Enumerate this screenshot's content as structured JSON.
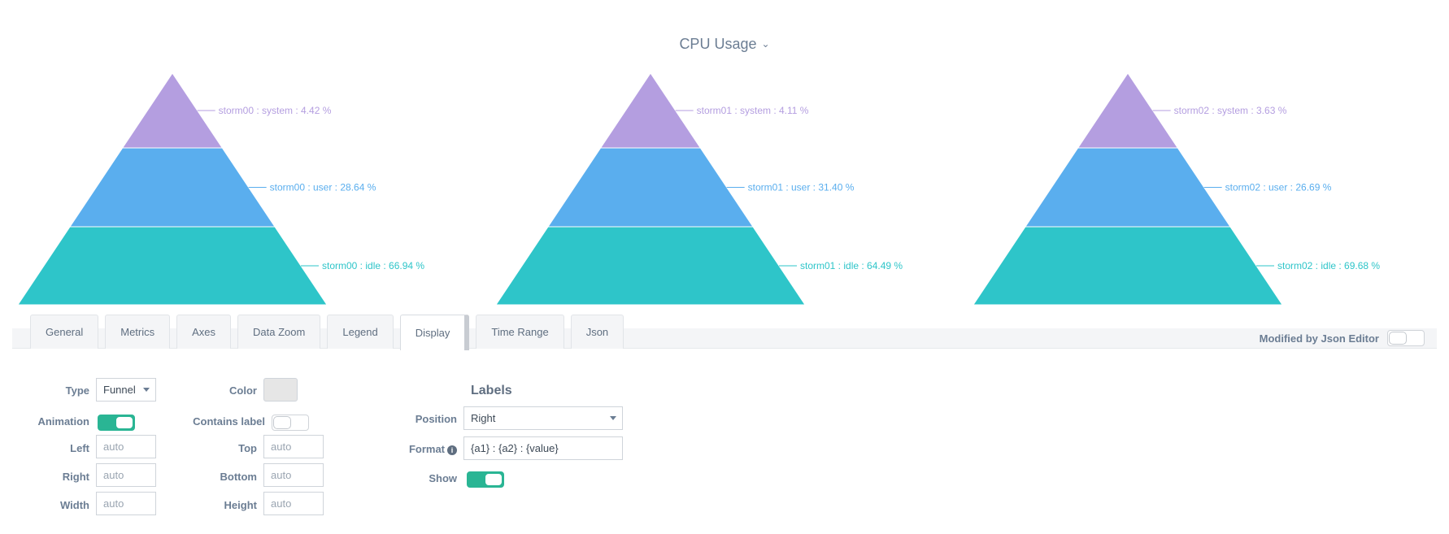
{
  "panel_title": "CPU Usage",
  "colors": {
    "system": "#b49ee0",
    "user": "#5aaeee",
    "idle": "#2ec5c9",
    "accent": "#2ab594"
  },
  "chart_data": [
    {
      "type": "funnel",
      "series": [
        {
          "label": "storm00 : system : 4.42 %",
          "value": 4.42
        },
        {
          "label": "storm00 : user : 28.64 %",
          "value": 28.64
        },
        {
          "label": "storm00 : idle : 66.94 %",
          "value": 66.94
        }
      ]
    },
    {
      "type": "funnel",
      "series": [
        {
          "label": "storm01 : system : 4.11 %",
          "value": 4.11
        },
        {
          "label": "storm01 : user : 31.40 %",
          "value": 31.4
        },
        {
          "label": "storm01 : idle : 64.49 %",
          "value": 64.49
        }
      ]
    },
    {
      "type": "funnel",
      "series": [
        {
          "label": "storm02 : system : 3.63 %",
          "value": 3.63
        },
        {
          "label": "storm02 : user : 26.69 %",
          "value": 26.69
        },
        {
          "label": "storm02 : idle : 69.68 %",
          "value": 69.68
        }
      ]
    }
  ],
  "tabs": [
    "General",
    "Metrics",
    "Axes",
    "Data Zoom",
    "Legend",
    "Display",
    "Time Range",
    "Json"
  ],
  "active_tab": "Display",
  "json_editor": {
    "label": "Modified by Json Editor",
    "enabled": false
  },
  "form": {
    "type_label": "Type",
    "type_value": "Funnel",
    "color_label": "Color",
    "animation_label": "Animation",
    "animation_on": true,
    "contains_label_label": "Contains label",
    "contains_label_on": false,
    "left_label": "Left",
    "left_placeholder": "auto",
    "top_label": "Top",
    "top_placeholder": "auto",
    "right_label": "Right",
    "right_placeholder": "auto",
    "bottom_label": "Bottom",
    "bottom_placeholder": "auto",
    "width_label": "Width",
    "width_placeholder": "auto",
    "height_label": "Height",
    "height_placeholder": "auto"
  },
  "labels": {
    "title": "Labels",
    "position_label": "Position",
    "position_value": "Right",
    "format_label": "Format",
    "format_value": "{a1} : {a2} : {value}",
    "show_label": "Show",
    "show_on": true
  }
}
